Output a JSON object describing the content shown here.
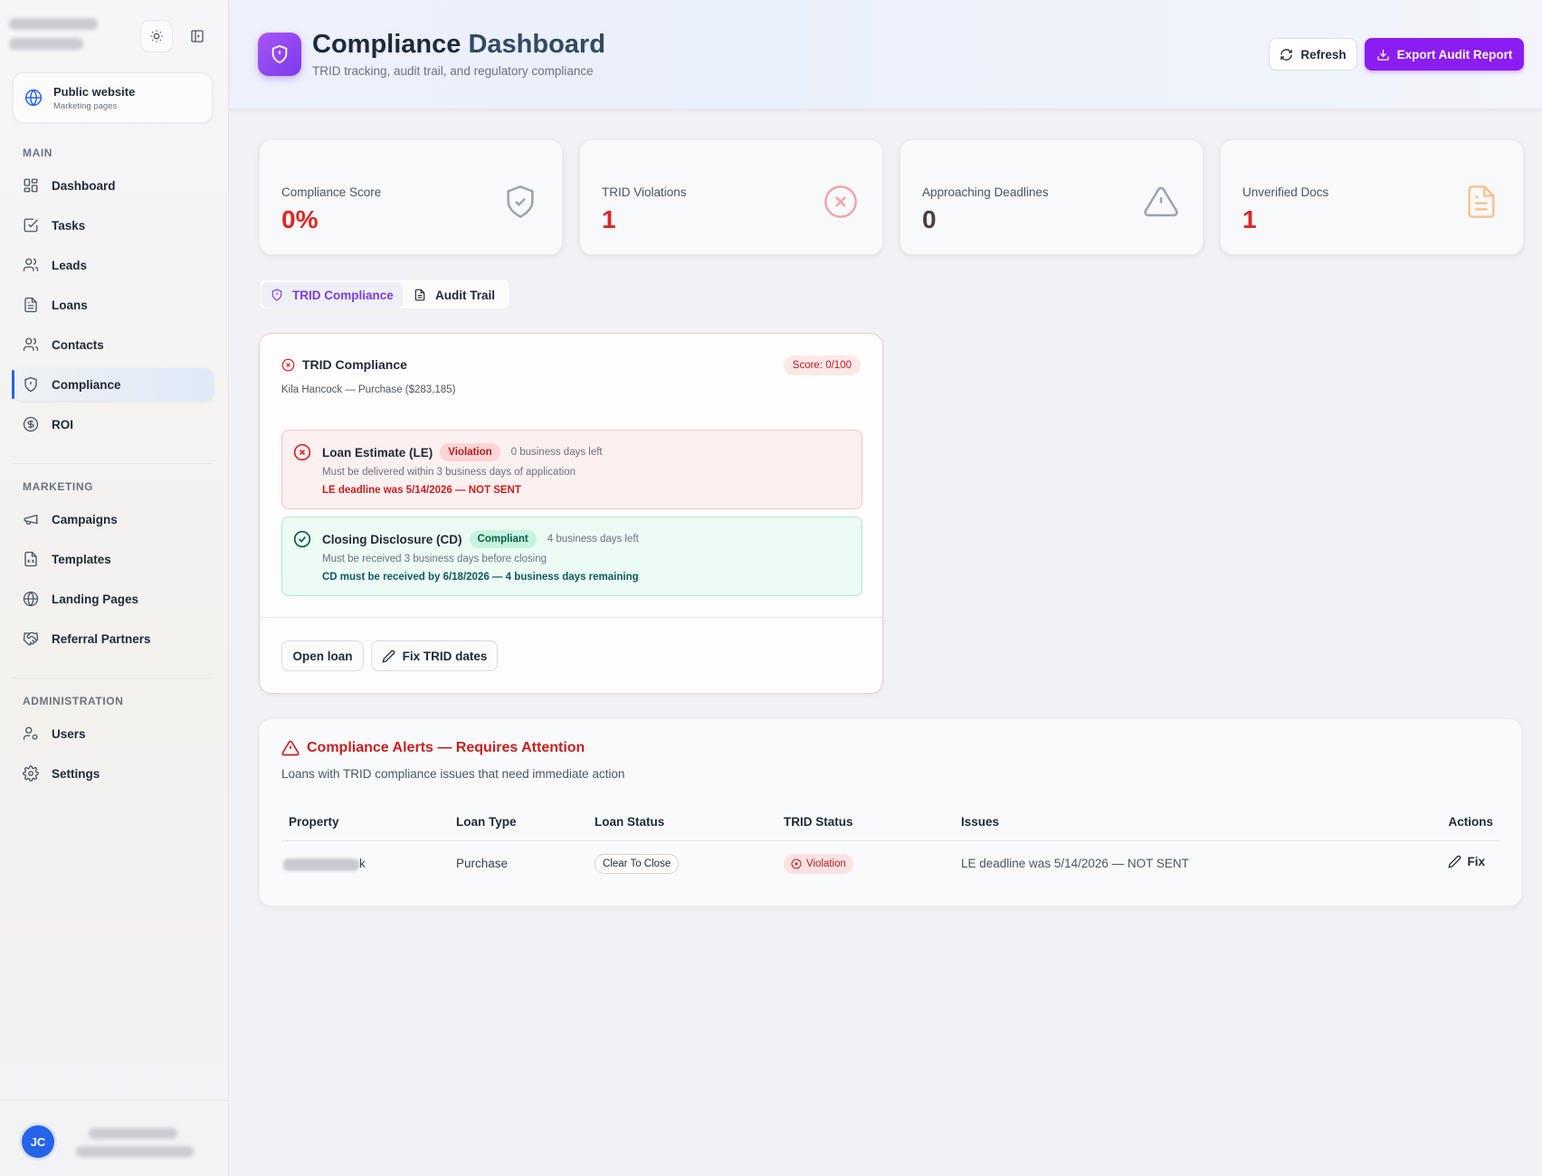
{
  "sidebar": {
    "public_card": {
      "title": "Public website",
      "subtitle": "Marketing pages"
    },
    "sections": {
      "main": "MAIN",
      "marketing": "MARKETING",
      "administration": "ADMINISTRATION"
    },
    "main_items": [
      "Dashboard",
      "Tasks",
      "Leads",
      "Loans",
      "Contacts",
      "Compliance",
      "ROI"
    ],
    "marketing_items": [
      "Campaigns",
      "Templates",
      "Landing Pages",
      "Referral Partners"
    ],
    "admin_items": [
      "Users",
      "Settings"
    ],
    "user": {
      "initials": "JC"
    }
  },
  "header": {
    "title_main": "Compliance",
    "title_accent": "Dashboard",
    "subtitle": "TRID tracking, audit trail, and regulatory compliance",
    "refresh_label": "Refresh",
    "export_label": "Export Audit Report"
  },
  "stats": [
    {
      "label": "Compliance Score",
      "value": "0%",
      "color": "#dc2626",
      "icon": "shield-check-icon"
    },
    {
      "label": "TRID Violations",
      "value": "1",
      "color": "#dc2626",
      "icon": "x-circle-icon"
    },
    {
      "label": "Approaching Deadlines",
      "value": "0",
      "color": "#4b3f3f",
      "icon": "alert-triangle-icon"
    },
    {
      "label": "Unverified Docs",
      "value": "1",
      "color": "#dc2626",
      "icon": "file-text-icon"
    }
  ],
  "tabs": {
    "trid": "TRID Compliance",
    "audit": "Audit Trail"
  },
  "trid_card": {
    "title": "TRID Compliance",
    "score": "Score: 0/100",
    "subtitle": "Kila Hancock — Purchase ($283,185)",
    "le": {
      "name": "Loan Estimate (LE)",
      "status": "Violation",
      "days": "0 business days left",
      "desc": "Must be delivered within 3 business days of application",
      "note": "LE deadline was 5/14/2026 — NOT SENT"
    },
    "cd": {
      "name": "Closing Disclosure (CD)",
      "status": "Compliant",
      "days": "4 business days left",
      "desc": "Must be received 3 business days before closing",
      "note": "CD must be received by 6/18/2026 — 4 business days remaining"
    },
    "open_loan_label": "Open loan",
    "fix_dates_label": "Fix TRID dates"
  },
  "alerts": {
    "title": "Compliance Alerts — Requires Attention",
    "subtitle": "Loans with TRID compliance issues that need immediate action",
    "columns": [
      "Property",
      "Loan Type",
      "Loan Status",
      "TRID Status",
      "Issues",
      "Actions"
    ],
    "rows": [
      {
        "property_suffix": "k",
        "loan_type": "Purchase",
        "loan_status": "Clear To Close",
        "trid_status": "Violation",
        "issues": "LE deadline was 5/14/2026 — NOT SENT",
        "action": "Fix"
      }
    ]
  }
}
